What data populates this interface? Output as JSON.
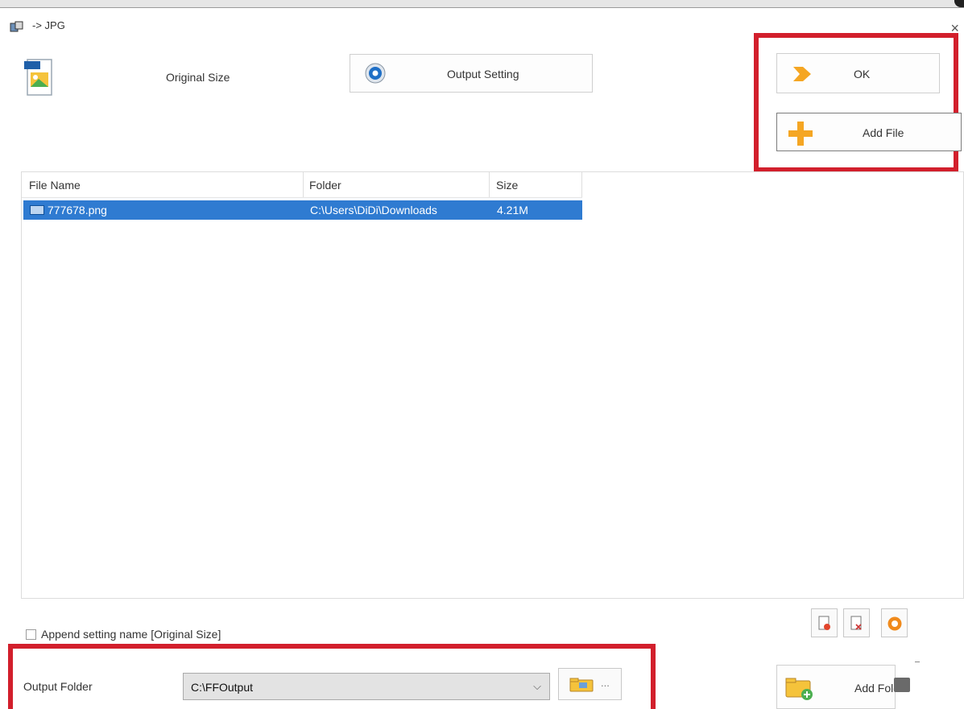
{
  "window": {
    "title": "-> JPG",
    "close_glyph": "×"
  },
  "header": {
    "profile_label": "Original Size",
    "output_setting_label": "Output Setting",
    "ok_label": "OK",
    "add_file_label": "Add File"
  },
  "file_list": {
    "columns": [
      "File Name",
      "Folder",
      "Size"
    ],
    "rows": [
      {
        "name": "777678.png",
        "folder": "C:\\Users\\DiDi\\Downloads",
        "size": "4.21M",
        "selected": true
      }
    ]
  },
  "options": {
    "append_label": "Append setting name [Original Size]",
    "append_checked": false
  },
  "output": {
    "folder_label": "Output Folder",
    "folder_value": "C:\\FFOutput",
    "dropdown_arrow": "⌵",
    "browse_dots": "...",
    "add_folder_label": "Add Folder"
  },
  "colors": {
    "highlight_red": "#d21f2c",
    "selection_blue": "#2f7bd1",
    "accent_orange": "#f5a623"
  },
  "icons": {
    "title": "app-convert-icon",
    "jpg": "jpg-file-icon",
    "output_setting": "settings-disc-icon",
    "ok": "arrow-right-icon",
    "add_file": "plus-icon",
    "row_file": "image-file-icon",
    "remove": "remove-file-icon",
    "clear": "clear-list-icon",
    "play": "play-icon",
    "browse": "folder-icon",
    "add_folder": "add-folder-icon"
  }
}
